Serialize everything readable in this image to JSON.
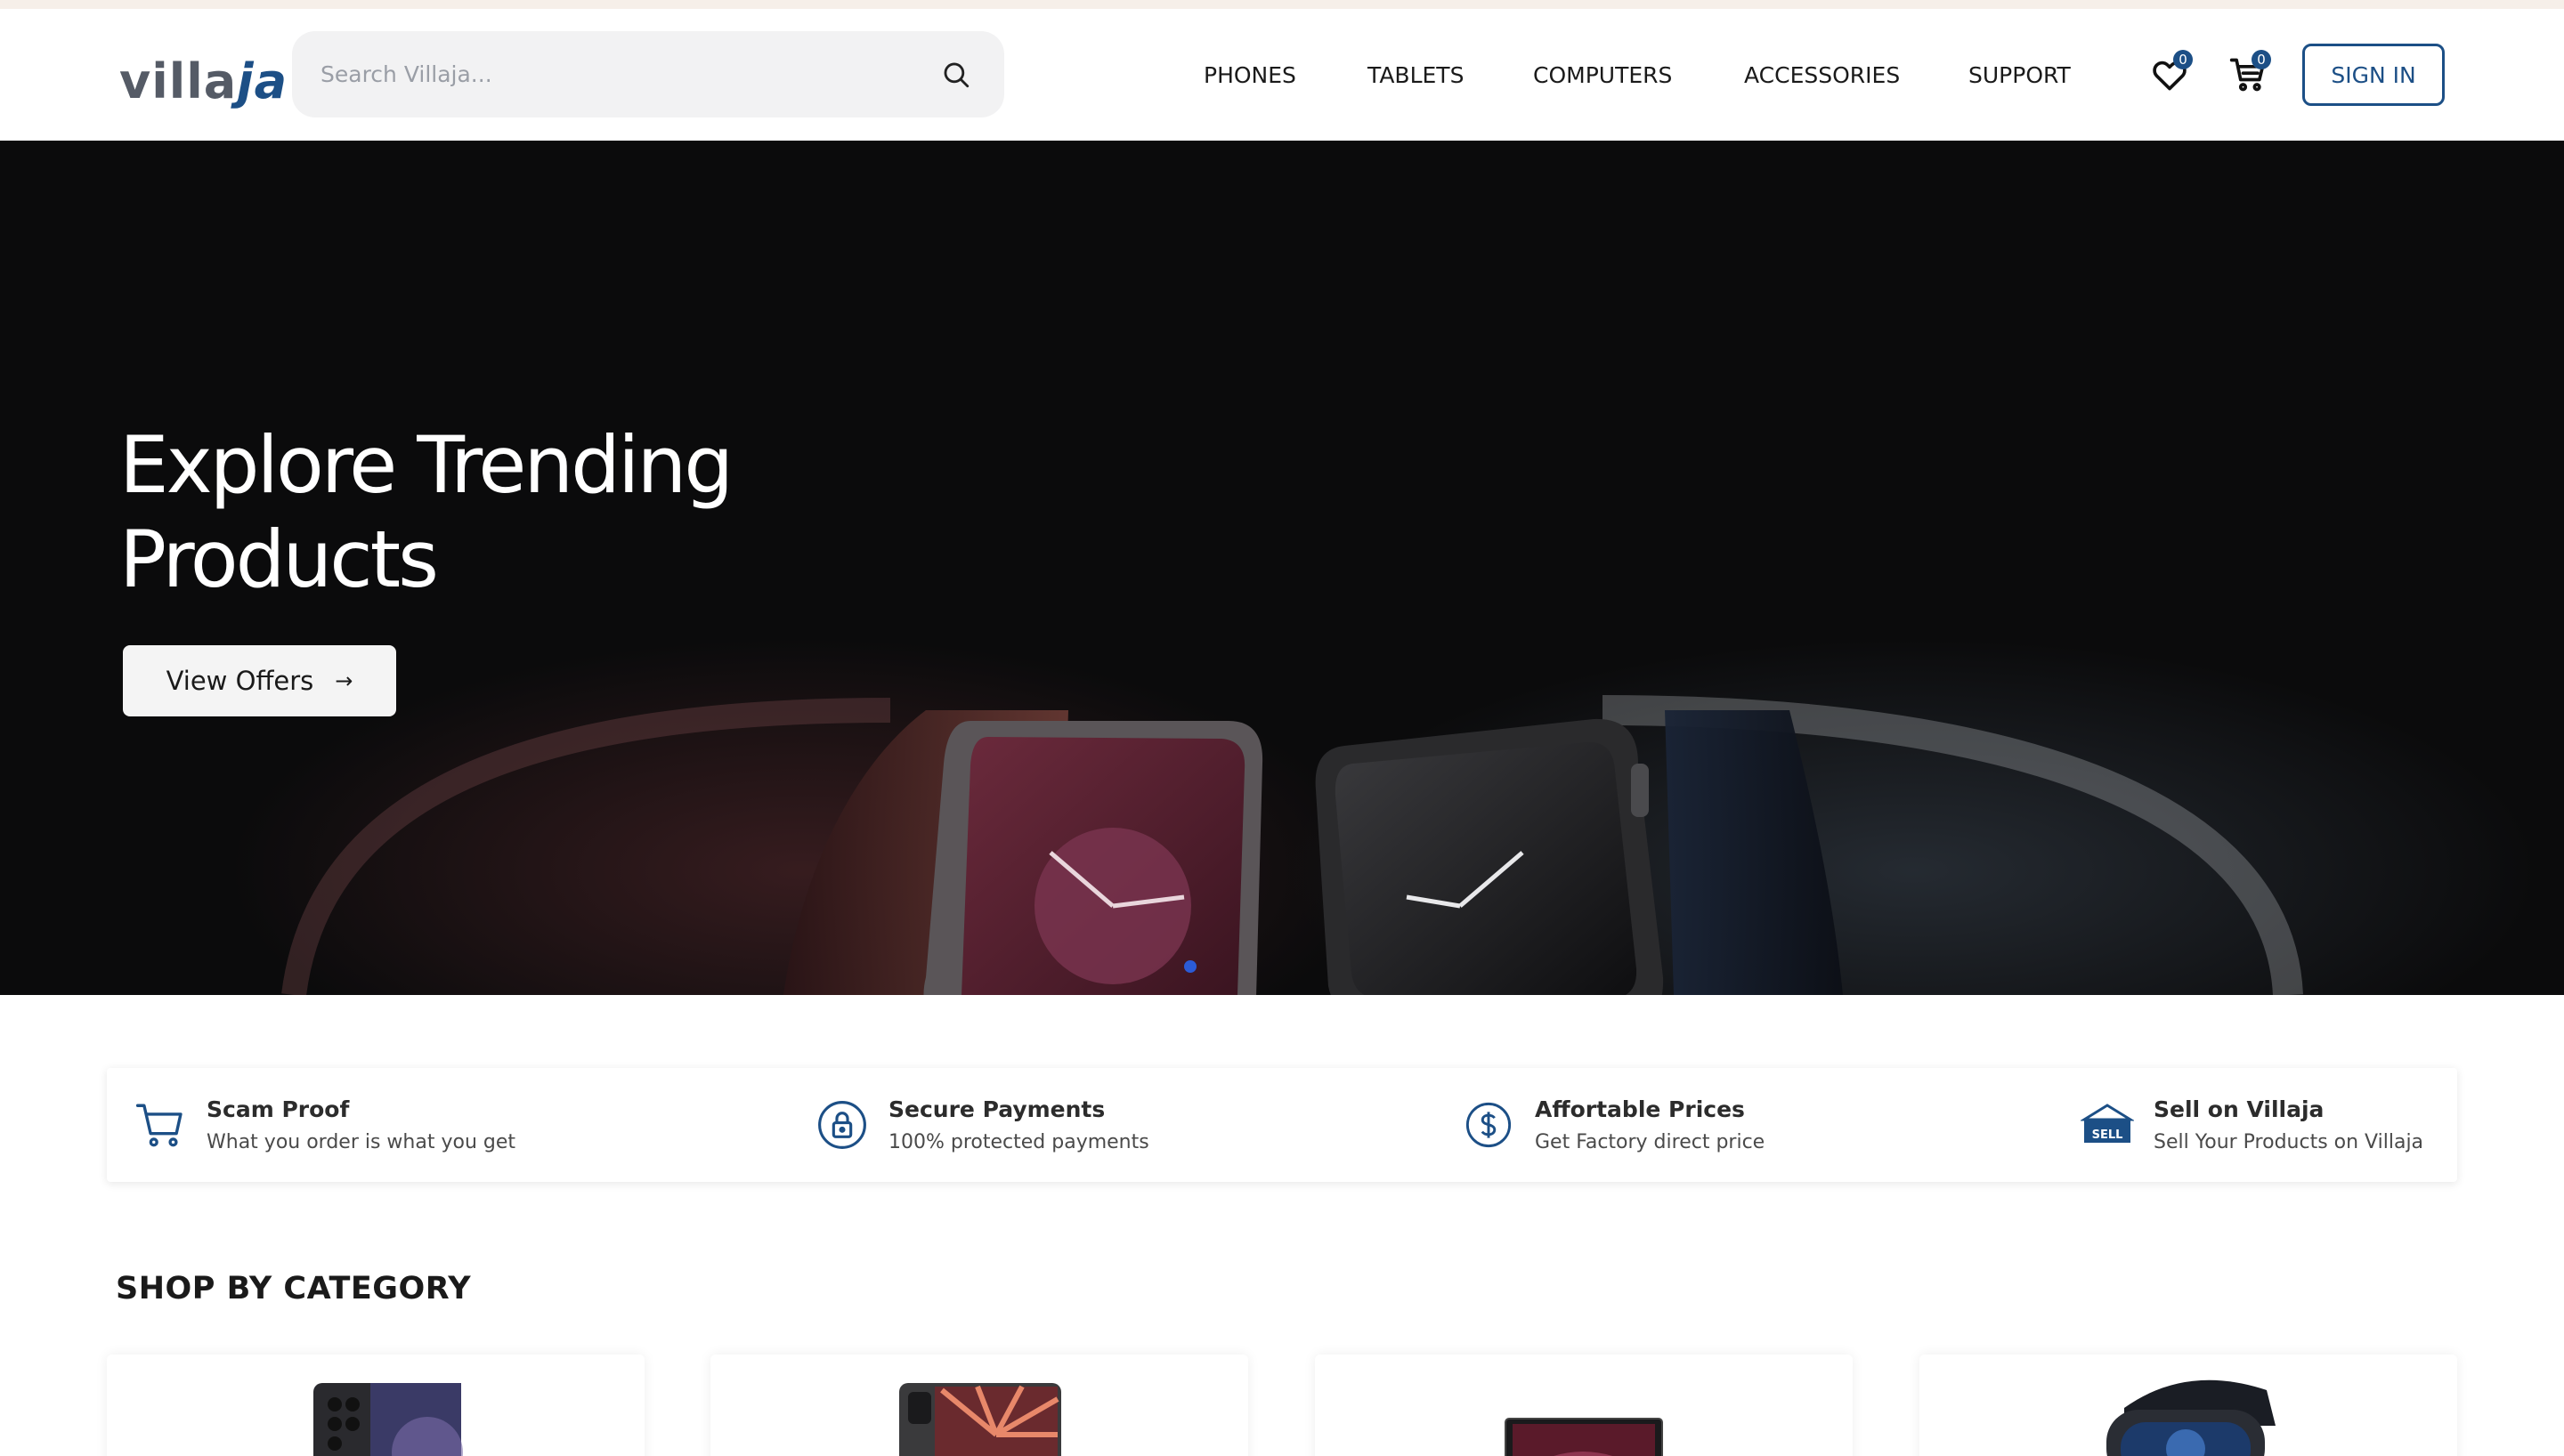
{
  "brand": {
    "logo_a": "villa",
    "logo_b": "ja"
  },
  "search": {
    "placeholder": "Search Villaja..."
  },
  "nav": {
    "phones": "PHONES",
    "tablets": "TABLETS",
    "computers": "COMPUTERS",
    "accessories": "ACCESSORIES",
    "support": "SUPPORT"
  },
  "header_actions": {
    "wishlist_count": "0",
    "cart_count": "0",
    "sign_in": "SIGN IN"
  },
  "hero": {
    "title_line1": "Explore Trending",
    "title_line2": "Products",
    "cta": "View Offers",
    "cta_arrow": "→"
  },
  "features": [
    {
      "title": "Scam Proof",
      "subtitle": "What you order is what you get",
      "icon": "cart-icon"
    },
    {
      "title": "Secure Payments",
      "subtitle": "100% protected payments",
      "icon": "lock-icon"
    },
    {
      "title": "Affortable Prices",
      "subtitle": "Get Factory direct price",
      "icon": "dollar-icon"
    },
    {
      "title": "Sell on Villaja",
      "subtitle": "Sell Your Products on Villaja",
      "icon": "sell-store-icon"
    }
  ],
  "shop_by_category": {
    "title": "SHOP BY CATEGORY"
  },
  "colors": {
    "brand_blue": "#1c4f86",
    "hero_bg": "#0b0b0c",
    "carousel_dot": "#2b5bd7"
  }
}
